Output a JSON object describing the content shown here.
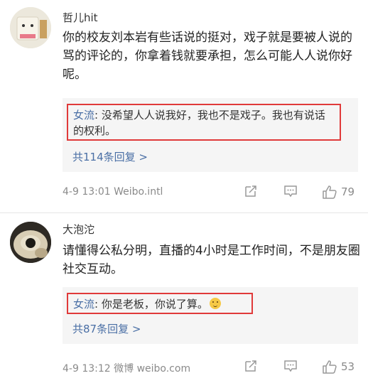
{
  "comments": [
    {
      "username": "哲儿hit",
      "text": "你的校友刘本岩有些话说的挺对，戏子就是要被人说的骂的评论的，你拿着钱就要承担，怎么可能人人说你好呢。",
      "reply": {
        "user": "女流",
        "text": ": 没希望人人说我好，我也不是戏子。我也有说话的权利。"
      },
      "more_replies": "共114条回复 >",
      "timestamp": "4-9 13:01",
      "source": "Weibo.intl",
      "likes": "79"
    },
    {
      "username": "大泡沱",
      "text": "请懂得公私分明，直播的4小时是工作时间，不是朋友圈社交互动。",
      "reply": {
        "user": "女流",
        "text": ": 你是老板，你说了算。"
      },
      "more_replies": "共87条回复 >",
      "timestamp": "4-9 13:12",
      "source": "微博 weibo.com",
      "likes": "53"
    }
  ],
  "icons": {
    "share": "share-icon",
    "comment": "comment-icon",
    "like": "thumbs-up-icon"
  },
  "colors": {
    "link": "#4a6fa5",
    "highlight_border": "#e03a3a",
    "meta_text": "#8a8a8a",
    "reply_bg": "#f5f5f5"
  }
}
